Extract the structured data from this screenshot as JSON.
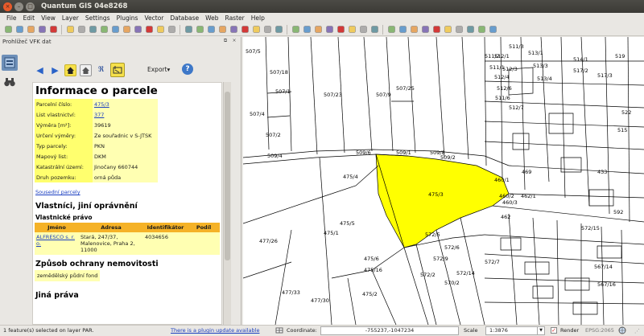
{
  "window": {
    "title": "Quantum GIS 04e8268",
    "close_glyph": "×",
    "min_glyph": "–",
    "max_glyph": "□"
  },
  "menu": [
    {
      "label": "File"
    },
    {
      "label": "Edit"
    },
    {
      "label": "View"
    },
    {
      "label": "Layer"
    },
    {
      "label": "Settings"
    },
    {
      "label": "Plugins"
    },
    {
      "label": "Vector"
    },
    {
      "label": "Database"
    },
    {
      "label": "Web"
    },
    {
      "label": "Raster"
    },
    {
      "label": "Help"
    }
  ],
  "toolbar": {
    "icons": [
      "new-icon",
      "open-icon",
      "save-icon",
      "save-as-icon",
      "print-icon",
      "digitize-icon",
      "edit-icon",
      "save-edits-icon",
      "add-feature-icon",
      "move-feature-icon",
      "node-icon",
      "delete-icon",
      "cut-icon",
      "copy-icon",
      "paste-icon",
      "pan-icon",
      "zoom-in-icon",
      "zoom-out-icon",
      "zoom-full-icon",
      "zoom-selection-icon",
      "zoom-layer-icon",
      "zoom-last-icon",
      "zoom-next-icon",
      "refresh-icon",
      "identify-icon",
      "settings-icon",
      "select-icon",
      "deselect-icon",
      "measure-icon",
      "measure-area-icon",
      "bookmark-icon",
      "tips-icon",
      "add-vector-icon",
      "add-raster-icon",
      "add-postgis-icon",
      "add-spatialite-icon",
      "add-wms-icon",
      "add-wfs-icon",
      "new-layer-icon",
      "remove-layer-icon",
      "python-icon",
      "plugin-icon"
    ]
  },
  "dock": {
    "title": "Prohlížeč VFK dat",
    "float_glyph": "⧉",
    "close_glyph": "×",
    "side_icons": [
      "load-data-icon",
      "binoculars-icon"
    ],
    "nav": {
      "back_glyph": "◀",
      "forward_glyph": "▶",
      "export_label": "Export▾",
      "help_glyph": "?"
    }
  },
  "parcel": {
    "title": "Informace o parcele",
    "rows": [
      {
        "key": "Parcelní číslo:",
        "value": "475/3",
        "link": true
      },
      {
        "key": "List vlastnictví:",
        "value": "377",
        "link": true
      },
      {
        "key": "Výměra [m²]:",
        "value": "39619",
        "link": false
      },
      {
        "key": "Určení výměry:",
        "value": "Ze souřadnic v S-JTSK",
        "link": false
      },
      {
        "key": "Typ parcely:",
        "value": "PKN",
        "link": false
      },
      {
        "key": "Mapový list:",
        "value": "DKM",
        "link": false
      },
      {
        "key": "Katastrální území:",
        "value": "Jinočany 660744",
        "link": false
      },
      {
        "key": "Druh pozemku:",
        "value": "orná půda",
        "link": false
      }
    ],
    "neighbours_link": "Sousední parcely",
    "owners_heading": "Vlastníci, jiní oprávnění",
    "ownership_heading": "Vlastnické právo",
    "owner_table": {
      "headers": [
        "Jméno",
        "Adresa",
        "Identifikátor",
        "Podíl"
      ],
      "rows": [
        {
          "name": "ALFRESCO s. r. o.",
          "address": "Stará, 247/37, Malenovice, Praha 2, 11000",
          "id": "4034656",
          "share": ""
        }
      ]
    },
    "protection_heading": "Způsob ochrany nemovitosti",
    "protection_value": "zemědělský půdní fond",
    "other_rights_heading": "Jiná práva"
  },
  "map": {
    "selected_color": "#ffff00",
    "labels": [
      "507/5",
      "507/18",
      "507/1",
      "507/23",
      "507/9",
      "507/25",
      "507/4",
      "507/2",
      "509/6",
      "509/1",
      "509/8",
      "509/2",
      "509/4",
      "475/4",
      "475/3",
      "475/5",
      "475/1",
      "477/26",
      "475/6",
      "475/16",
      "477/33",
      "477/30",
      "475/2",
      "572/5",
      "572/6",
      "572/9",
      "572/14",
      "570/2",
      "572/2",
      "511/3",
      "511/2",
      "511/1",
      "511/6",
      "512/1",
      "512/3",
      "512/4",
      "512/6",
      "512/7",
      "513/1",
      "513/3",
      "513/4",
      "514/1",
      "517/2",
      "517/3",
      "519",
      "522",
      "515",
      "433",
      "460/1",
      "460/2",
      "460/3",
      "462/1",
      "469",
      "462",
      "572/7",
      "567/14",
      "567/16",
      "572/15",
      "592"
    ]
  },
  "status": {
    "message": "1 feature(s) selected on layer PAR.",
    "plugin_update": "There is a plugin update available",
    "coordinate_label": "Coordinate:",
    "coordinate": "-755237,-1047234",
    "scale_label": "Scale",
    "scale": "1:3876",
    "render_checked": "✓",
    "render_label": "Render",
    "epsg": "EPSG:2065"
  }
}
